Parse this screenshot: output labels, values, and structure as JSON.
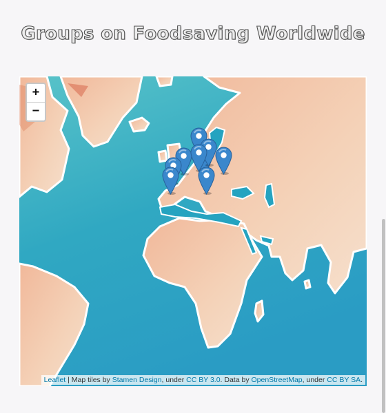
{
  "page": {
    "title": "Groups on Foodsaving Worldwide"
  },
  "map": {
    "tiles": "watercolor",
    "land_color": "#efc8a8",
    "water_color": "#35aec3",
    "zoom_controls": {
      "zoom_in": "+",
      "zoom_out": "−"
    },
    "marker_color": "#3a87cc",
    "marker_count": 9,
    "attribution": {
      "leaflet": "Leaflet",
      "sep": " | Map tiles by ",
      "stamen": "Stamen Design",
      "under1": ", under ",
      "ccby": "CC BY 3.0",
      "data_by": ". Data by ",
      "osm": "OpenStreetMap",
      "under2": ", under ",
      "ccbysa": "CC BY SA",
      "end": "."
    }
  }
}
